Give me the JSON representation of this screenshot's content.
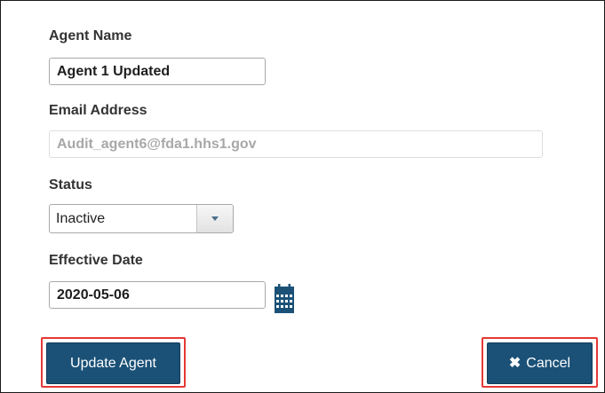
{
  "form": {
    "agent_name": {
      "label": "Agent Name",
      "value": "Agent 1 Updated"
    },
    "email": {
      "label": "Email Address",
      "value": "Audit_agent6@fda1.hhs1.gov"
    },
    "status": {
      "label": "Status",
      "selected": "Inactive"
    },
    "effective_date": {
      "label": "Effective Date",
      "value": "2020-05-06",
      "icon": "calendar-icon"
    }
  },
  "actions": {
    "update_label": "Update Agent",
    "cancel_label": "Cancel",
    "cancel_icon": "close-icon",
    "highlight_color": "#e53935",
    "button_color": "#1b5177"
  }
}
